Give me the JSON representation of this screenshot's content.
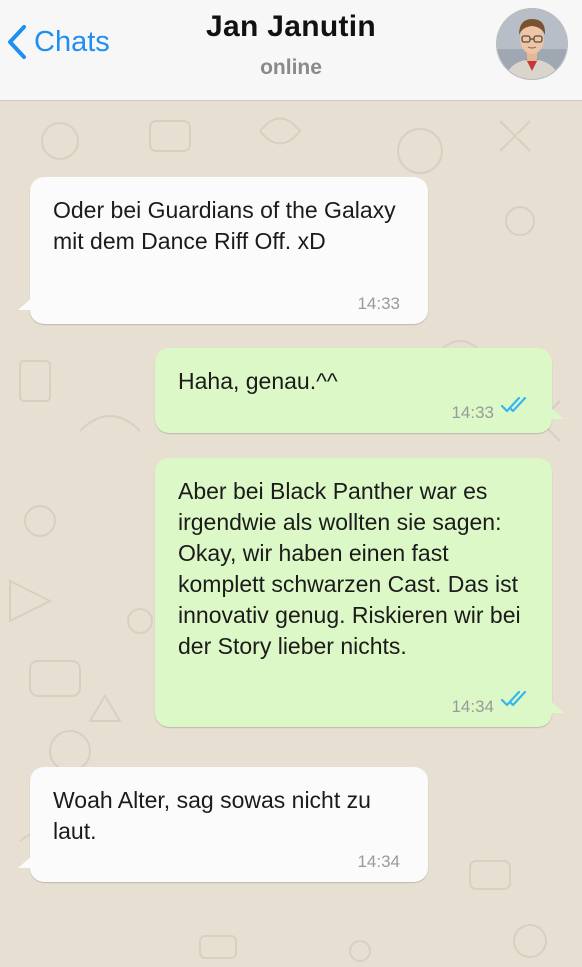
{
  "header": {
    "back_label": "Chats",
    "contact_name": "Jan Janutin",
    "status": "online",
    "accent_color": "#1f8ff0"
  },
  "messages": [
    {
      "direction": "incoming",
      "text": "Oder bei Guardians of the Galaxy mit dem Dance Riff Off. xD",
      "time": "14:33"
    },
    {
      "direction": "outgoing",
      "text": "Haha, genau.^^",
      "time": "14:33",
      "read": true
    },
    {
      "direction": "outgoing",
      "text": "Aber bei Black Panther war es irgendwie als wollten sie sagen: Okay, wir haben einen fast komplett schwarzen Cast. Das ist innovativ genug. Riskieren wir bei der Story lieber nichts.",
      "time": "14:34",
      "read": true
    },
    {
      "direction": "incoming",
      "text": "Woah Alter, sag sowas nicht zu laut.",
      "time": "14:34"
    }
  ],
  "colors": {
    "incoming_bubble": "#fbfbfb",
    "outgoing_bubble": "#dcf8c6",
    "read_ticks": "#34b7f1",
    "wallpaper": "#e6dfd2"
  }
}
